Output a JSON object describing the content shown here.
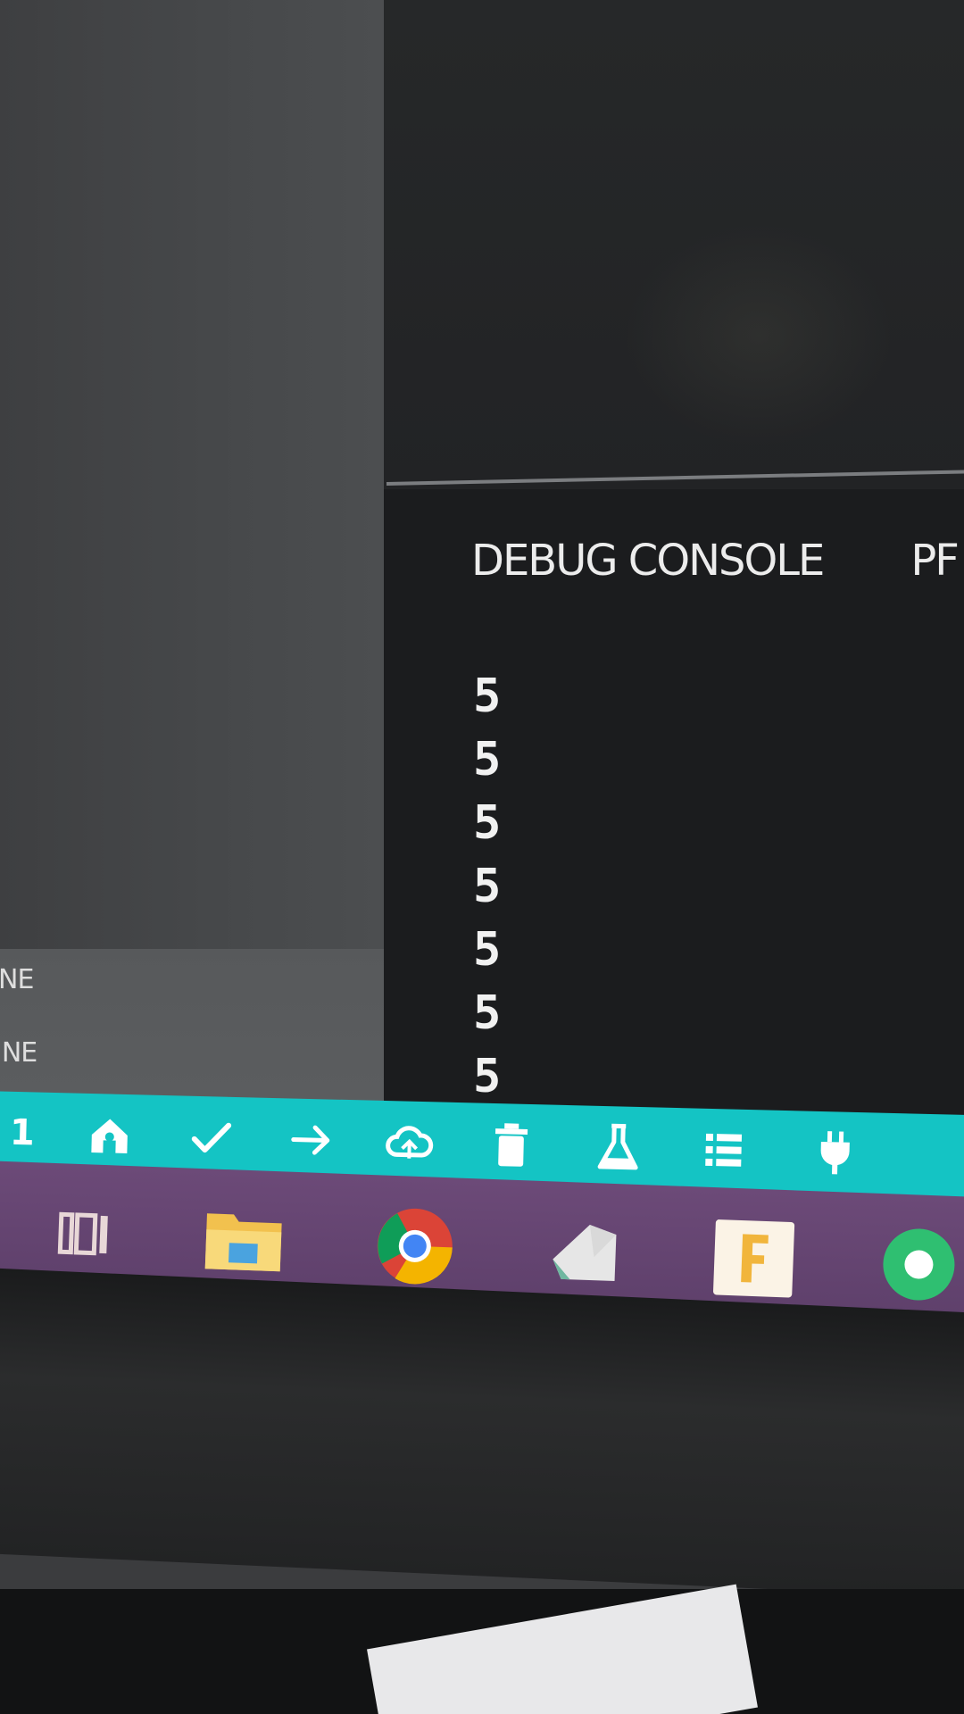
{
  "explorer": {
    "lines": [
      "NE",
      "INE"
    ]
  },
  "panel": {
    "tabs": [
      {
        "label": "DEBUG CONSOLE"
      },
      {
        "label": "PF"
      }
    ],
    "console_lines": [
      "5",
      "5",
      "5",
      "5",
      "5",
      "5",
      "5"
    ]
  },
  "status_bar": {
    "color": "#14c4c4",
    "problem_count": "1",
    "icons": [
      "home-icon",
      "check-icon",
      "arrow-right-icon",
      "cloud-upload-icon",
      "trash-icon",
      "flask-icon",
      "list-icon",
      "plug-icon"
    ]
  },
  "taskbar": {
    "color": "#6c4a78",
    "apps": [
      "task-view-icon",
      "file-explorer-icon",
      "chrome-icon",
      "paint-icon",
      "f-app-icon",
      "green-app-icon"
    ]
  }
}
